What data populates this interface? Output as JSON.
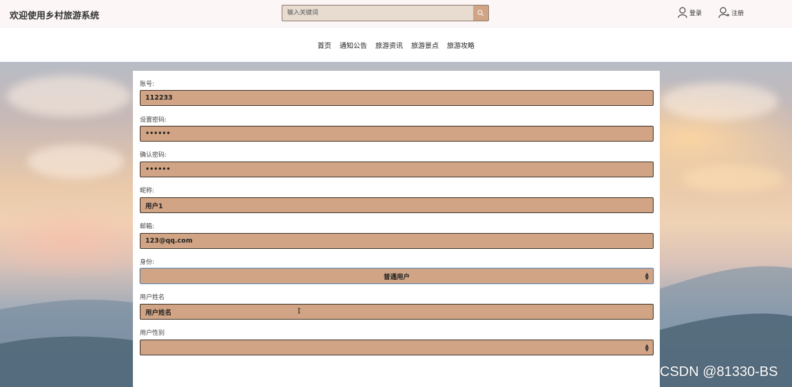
{
  "header": {
    "brand": "欢迎使用乡村旅游系统",
    "search_placeholder": "输入关键词",
    "login_label": "登录",
    "register_label": "注册"
  },
  "nav": {
    "items": [
      "首页",
      "通知公告",
      "旅游资讯",
      "旅游景点",
      "旅游攻略"
    ]
  },
  "form": {
    "account": {
      "label": "账号:",
      "value": "112233"
    },
    "password": {
      "label": "设置密码:",
      "value": "••••••"
    },
    "confirm_password": {
      "label": "确认密码:",
      "value": "••••••"
    },
    "nickname": {
      "label": "昵称:",
      "value": "用户1"
    },
    "email": {
      "label": "邮箱:",
      "value": "123@qq.com"
    },
    "identity": {
      "label": "身份:",
      "value": "普通用户"
    },
    "real_name": {
      "label": "用户姓名",
      "value": "用户姓名"
    },
    "gender": {
      "label": "用户性别",
      "value": ""
    }
  },
  "watermark": "CSDN @81330-BS",
  "colors": {
    "field_bg": "#d1a485",
    "search_bg": "#e7dccf",
    "header_bg": "#fdf6f6"
  }
}
